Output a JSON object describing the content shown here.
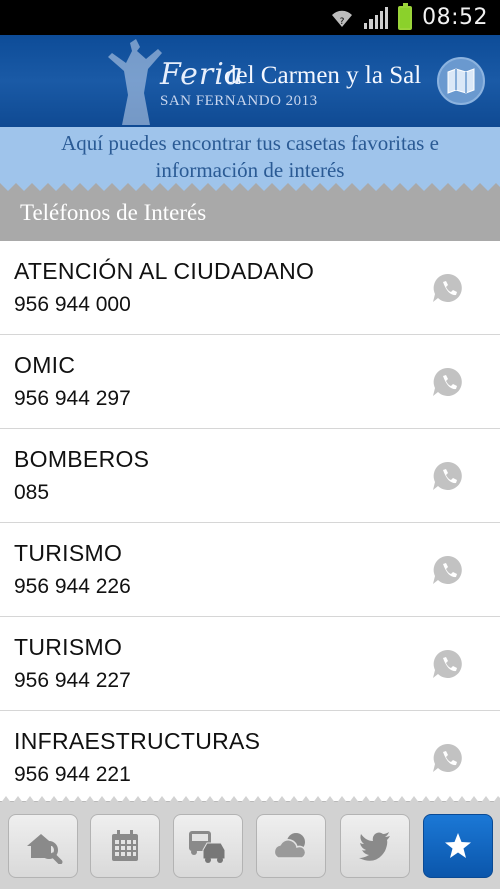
{
  "status_bar": {
    "time": "08:52"
  },
  "header": {
    "logo_script": "Feria",
    "logo_main": "del Carmen y la Sal",
    "logo_sub": "SAN FERNANDO 2013"
  },
  "intro": {
    "line1": "Aquí puedes encontrar tus casetas favoritas e",
    "line2": "información de interés"
  },
  "section": {
    "title": "Teléfonos de Interés"
  },
  "contacts": [
    {
      "name": "ATENCIÓN AL CIUDADANO",
      "phone": "956 944 000"
    },
    {
      "name": "OMIC",
      "phone": "956 944 297"
    },
    {
      "name": "BOMBEROS",
      "phone": "085"
    },
    {
      "name": "TURISMO",
      "phone": "956 944 226"
    },
    {
      "name": "TURISMO",
      "phone": "956 944 227"
    },
    {
      "name": "INFRAESTRUCTURAS",
      "phone": "956 944 221"
    }
  ],
  "tabs": [
    {
      "icon": "house-search-icon"
    },
    {
      "icon": "calendar-icon"
    },
    {
      "icon": "transport-icon"
    },
    {
      "icon": "weather-icon"
    },
    {
      "icon": "twitter-bird-icon"
    },
    {
      "icon": "star-icon",
      "active": true
    }
  ],
  "colors": {
    "banner": "#0d4c98",
    "intro_bg": "#9fc4eb",
    "intro_text": "#2a5a94",
    "section_bg": "#a9a9a9",
    "active_tab": "#1b78d6"
  }
}
